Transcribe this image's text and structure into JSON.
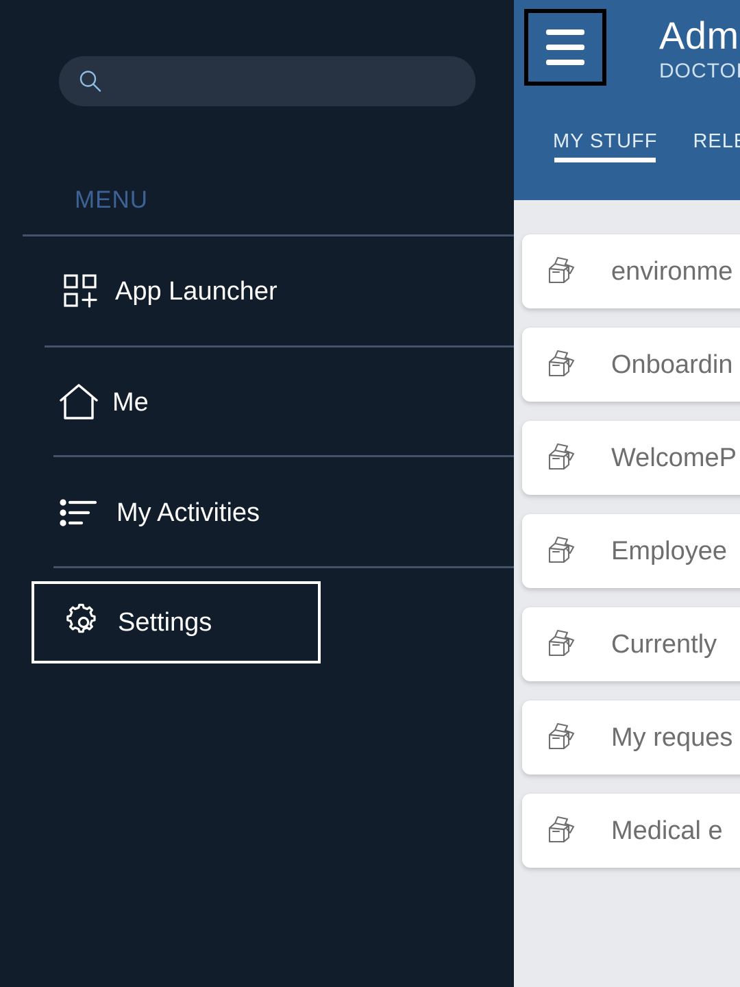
{
  "sidebar": {
    "search": {
      "placeholder": "",
      "value": "",
      "icon": "search-icon"
    },
    "section_label": "MENU",
    "items": [
      {
        "label": "App Launcher",
        "icon": "app-launcher-icon"
      },
      {
        "label": "Me",
        "icon": "home-icon"
      },
      {
        "label": "My Activities",
        "icon": "list-icon"
      },
      {
        "label": "Settings",
        "icon": "gear-icon",
        "selected": true
      }
    ]
  },
  "right_panel": {
    "header": {
      "menu_button_icon": "hamburger-menu-icon",
      "title": "Admo",
      "subtitle": "DOCTOR,"
    },
    "tabs": [
      {
        "label": "MY STUFF",
        "active": true
      },
      {
        "label": "RELEV",
        "active": false
      }
    ],
    "cards": [
      {
        "label": "environme",
        "icon": "open-box-icon"
      },
      {
        "label": "Onboardin",
        "icon": "open-box-icon"
      },
      {
        "label": "WelcomeP",
        "icon": "open-box-icon"
      },
      {
        "label": "Employee",
        "icon": "open-box-icon"
      },
      {
        "label": "Currently",
        "icon": "open-box-icon"
      },
      {
        "label": "My reques",
        "icon": "open-box-icon"
      },
      {
        "label": "Medical e",
        "icon": "open-box-icon"
      }
    ]
  },
  "colors": {
    "sidebar_bg": "#121d2c",
    "search_bg": "#273243",
    "menu_accent": "#3d6396",
    "divider": "#45536a",
    "header_blue": "#2e6296",
    "panel_bg": "#e8eaee",
    "card_bg": "#ffffff",
    "card_text": "#6e6e6e",
    "focus_outline": "#ffffff",
    "menu_button_outline": "#000000"
  }
}
